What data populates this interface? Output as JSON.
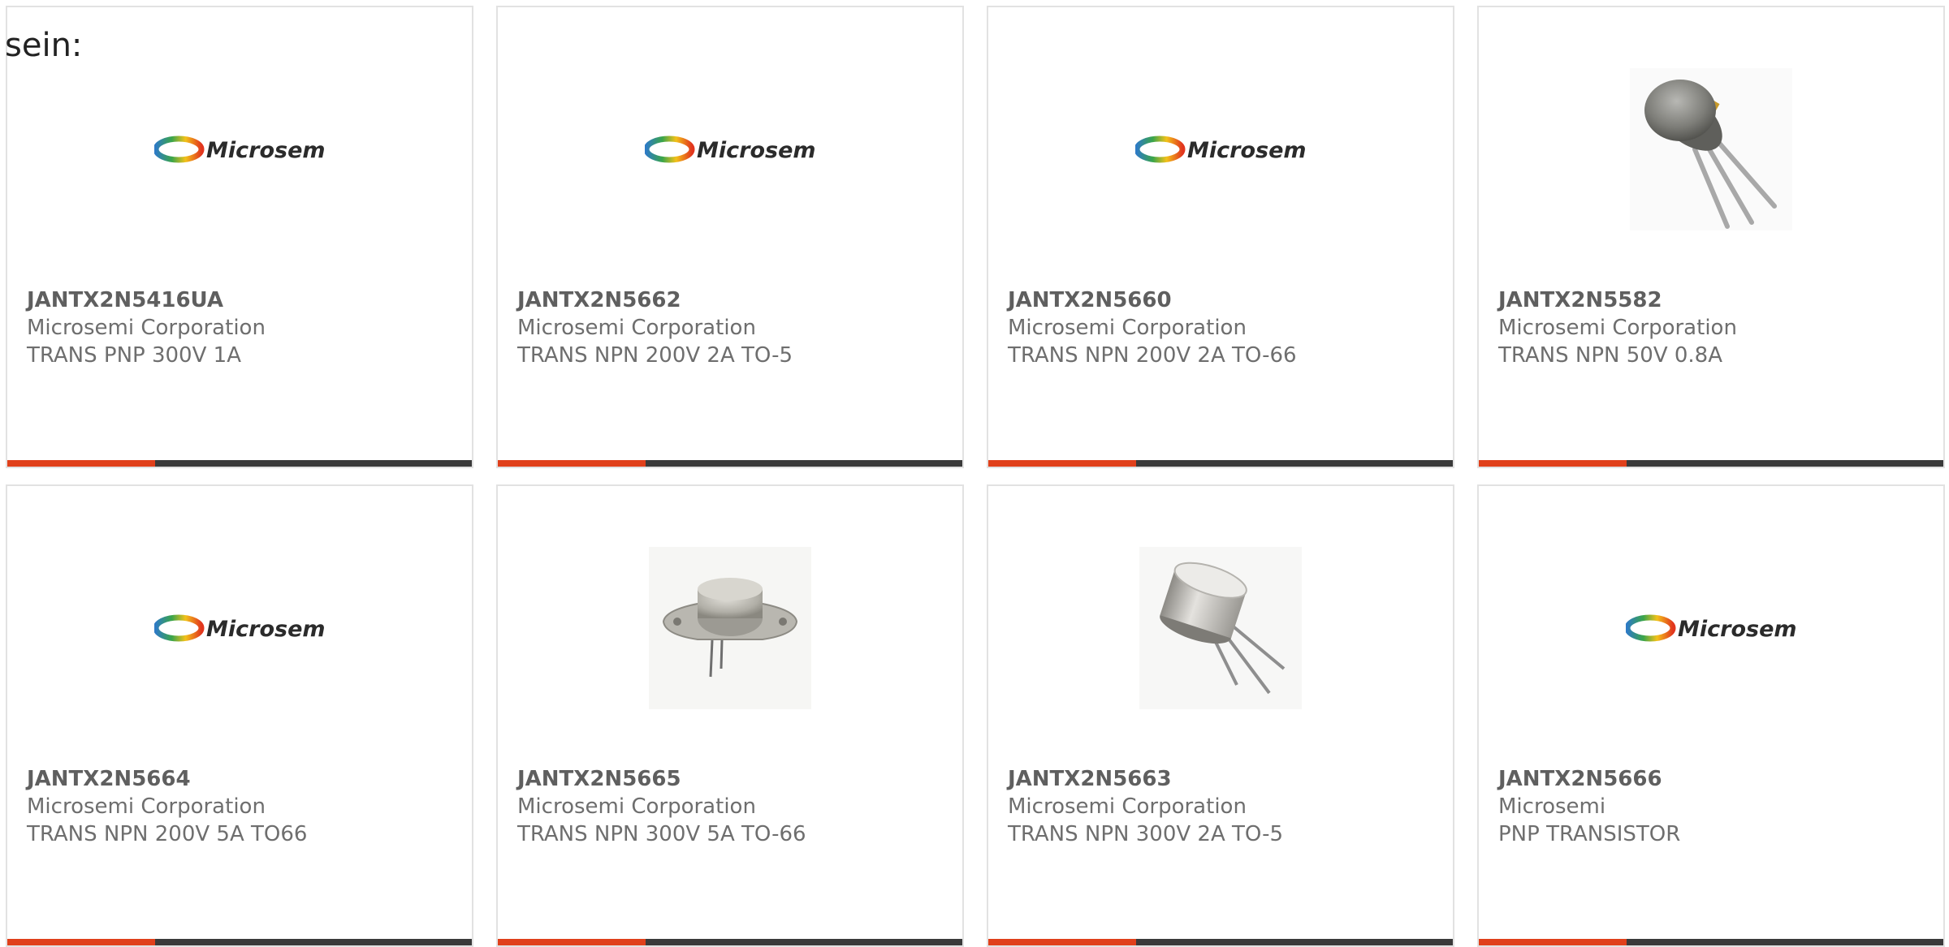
{
  "intro_text": "sein:",
  "colors": {
    "accent": "#e0401b",
    "bar_dark": "#3a3a3a",
    "text": "#6e6e6e",
    "border": "#e2e2e2"
  },
  "products": [
    {
      "part_number": "JANTX2N5416UA",
      "manufacturer": "Microsemi Corporation",
      "description": "TRANS PNP 300V 1A",
      "image": "microsemi-logo",
      "logo_text": "Microsemi"
    },
    {
      "part_number": "JANTX2N5662",
      "manufacturer": "Microsemi Corporation",
      "description": "TRANS NPN 200V 2A TO-5",
      "image": "microsemi-logo",
      "logo_text": "Microsemi"
    },
    {
      "part_number": "JANTX2N5660",
      "manufacturer": "Microsemi Corporation",
      "description": "TRANS NPN 200V 2A TO-66",
      "image": "microsemi-logo",
      "logo_text": "Microsemi"
    },
    {
      "part_number": "JANTX2N5582",
      "manufacturer": "Microsemi Corporation",
      "description": "TRANS NPN 50V 0.8A",
      "image": "to-can-transistor-photo"
    },
    {
      "part_number": "JANTX2N5664",
      "manufacturer": "Microsemi Corporation",
      "description": "TRANS NPN 200V 5A TO66",
      "image": "microsemi-logo",
      "logo_text": "Microsemi"
    },
    {
      "part_number": "JANTX2N5665",
      "manufacturer": "Microsemi Corporation",
      "description": "TRANS NPN 300V 5A TO-66",
      "image": "to66-transistor-photo"
    },
    {
      "part_number": "JANTX2N5663",
      "manufacturer": "Microsemi Corporation",
      "description": "TRANS NPN 300V 2A TO-5",
      "image": "to5-transistor-photo"
    },
    {
      "part_number": "JANTX2N5666",
      "manufacturer": "Microsemi",
      "description": "PNP TRANSISTOR",
      "image": "microsemi-logo",
      "logo_text": "Microsemi"
    }
  ]
}
